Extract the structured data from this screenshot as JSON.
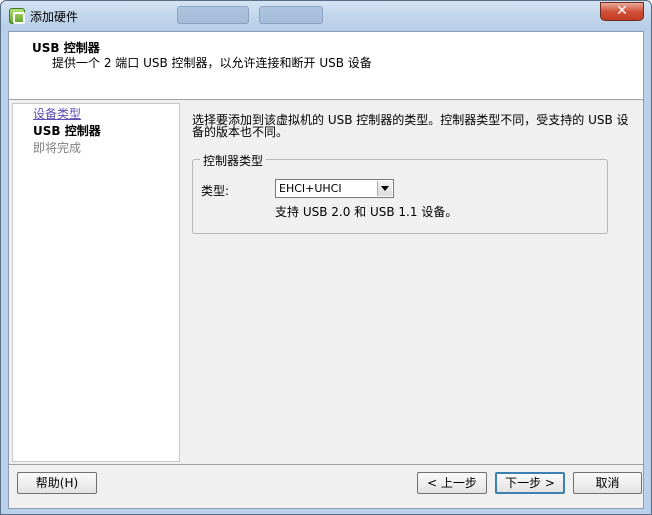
{
  "window": {
    "title": "添加硬件",
    "close_label": "✕"
  },
  "header": {
    "title": "USB 控制器",
    "subtitle": "提供一个 2 端口 USB 控制器，以允许连接和断开 USB 设备"
  },
  "steps": {
    "items": [
      {
        "label": "设备类型",
        "state": "done"
      },
      {
        "label": "USB 控制器",
        "state": "current"
      },
      {
        "label": "即将完成",
        "state": "pending"
      }
    ]
  },
  "main": {
    "description": "选择要添加到该虚拟机的 USB 控制器的类型。控制器类型不同，受支持的 USB 设备的版本也不同。",
    "group_title": "控制器类型",
    "type_label": "类型:",
    "type_value": "EHCI+UHCI",
    "support_text": "支持 USB 2.0 和 USB 1.1 设备。"
  },
  "buttons": {
    "help": "帮助(H)",
    "back": "< 上一步",
    "next": "下一步 >",
    "cancel": "取消"
  },
  "colors": {
    "titlebar": "#c3d7ec",
    "close": "#c23a1f",
    "link": "#5b4fb5",
    "default_button_border": "#3c7fb1"
  }
}
